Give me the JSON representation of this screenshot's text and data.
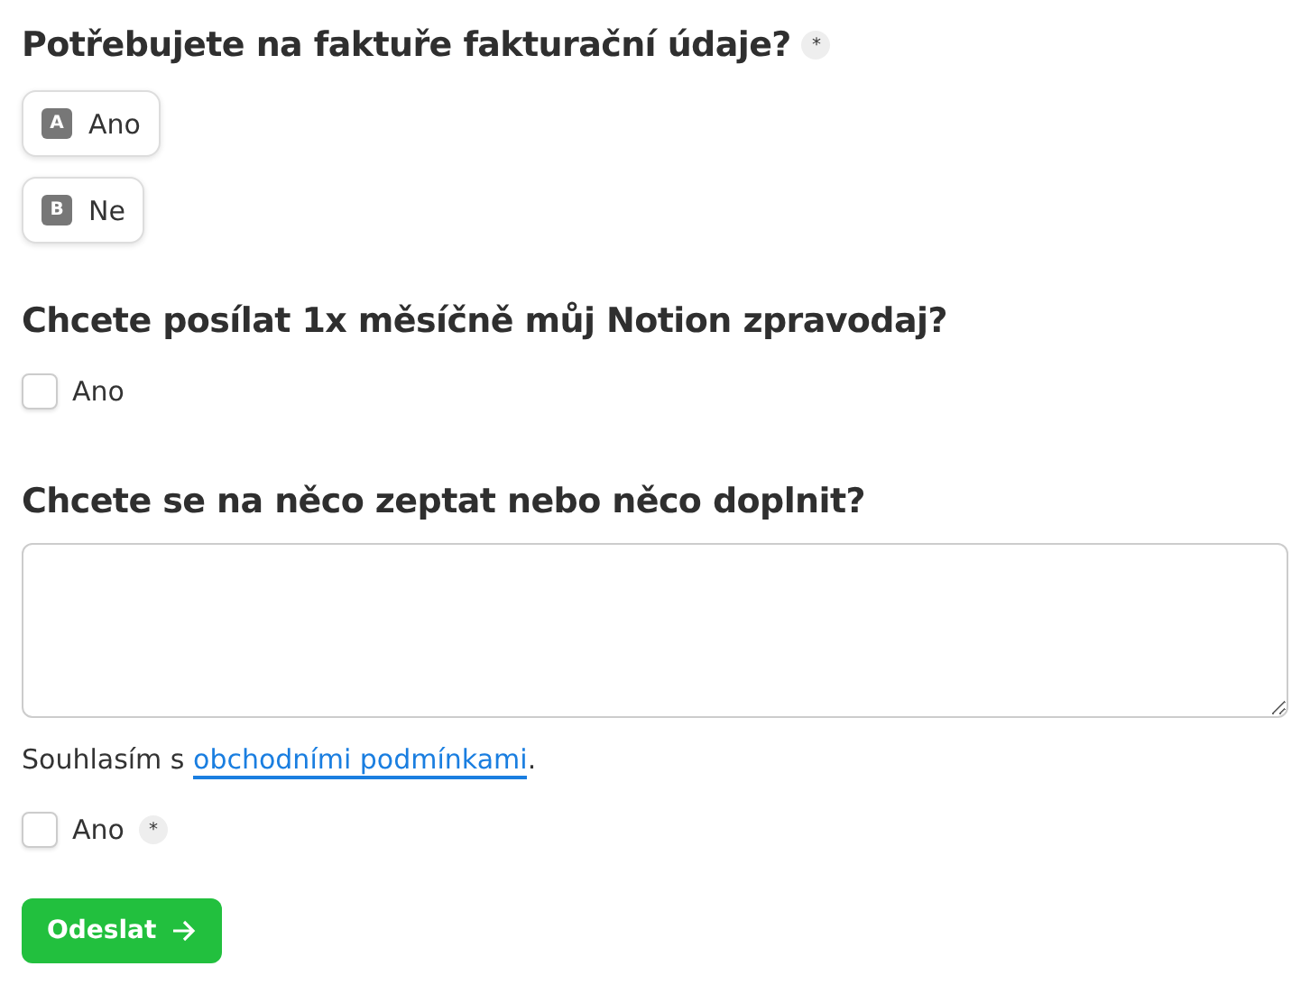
{
  "questions": [
    {
      "kind": "choice",
      "title": "Potřebujete na faktuře fakturační údaje?",
      "required_mark": "*",
      "options": [
        {
          "key": "A",
          "label": "Ano",
          "selected": false
        },
        {
          "key": "B",
          "label": "Ne",
          "selected": false
        }
      ]
    },
    {
      "kind": "checkbox",
      "title": "Chcete posílat 1x měsíčně můj Notion zpravodaj?",
      "label": "Ano",
      "checked": false
    },
    {
      "kind": "text",
      "title": "Chcete se na něco zeptat nebo něco doplnit?"
    }
  ],
  "consent": {
    "before": "Souhlasím s ",
    "link": "obchodními podmínkami",
    "after": ".",
    "label": "Ano",
    "checked": false,
    "required_mark": "*"
  },
  "submit": {
    "label": "Odeslat"
  }
}
